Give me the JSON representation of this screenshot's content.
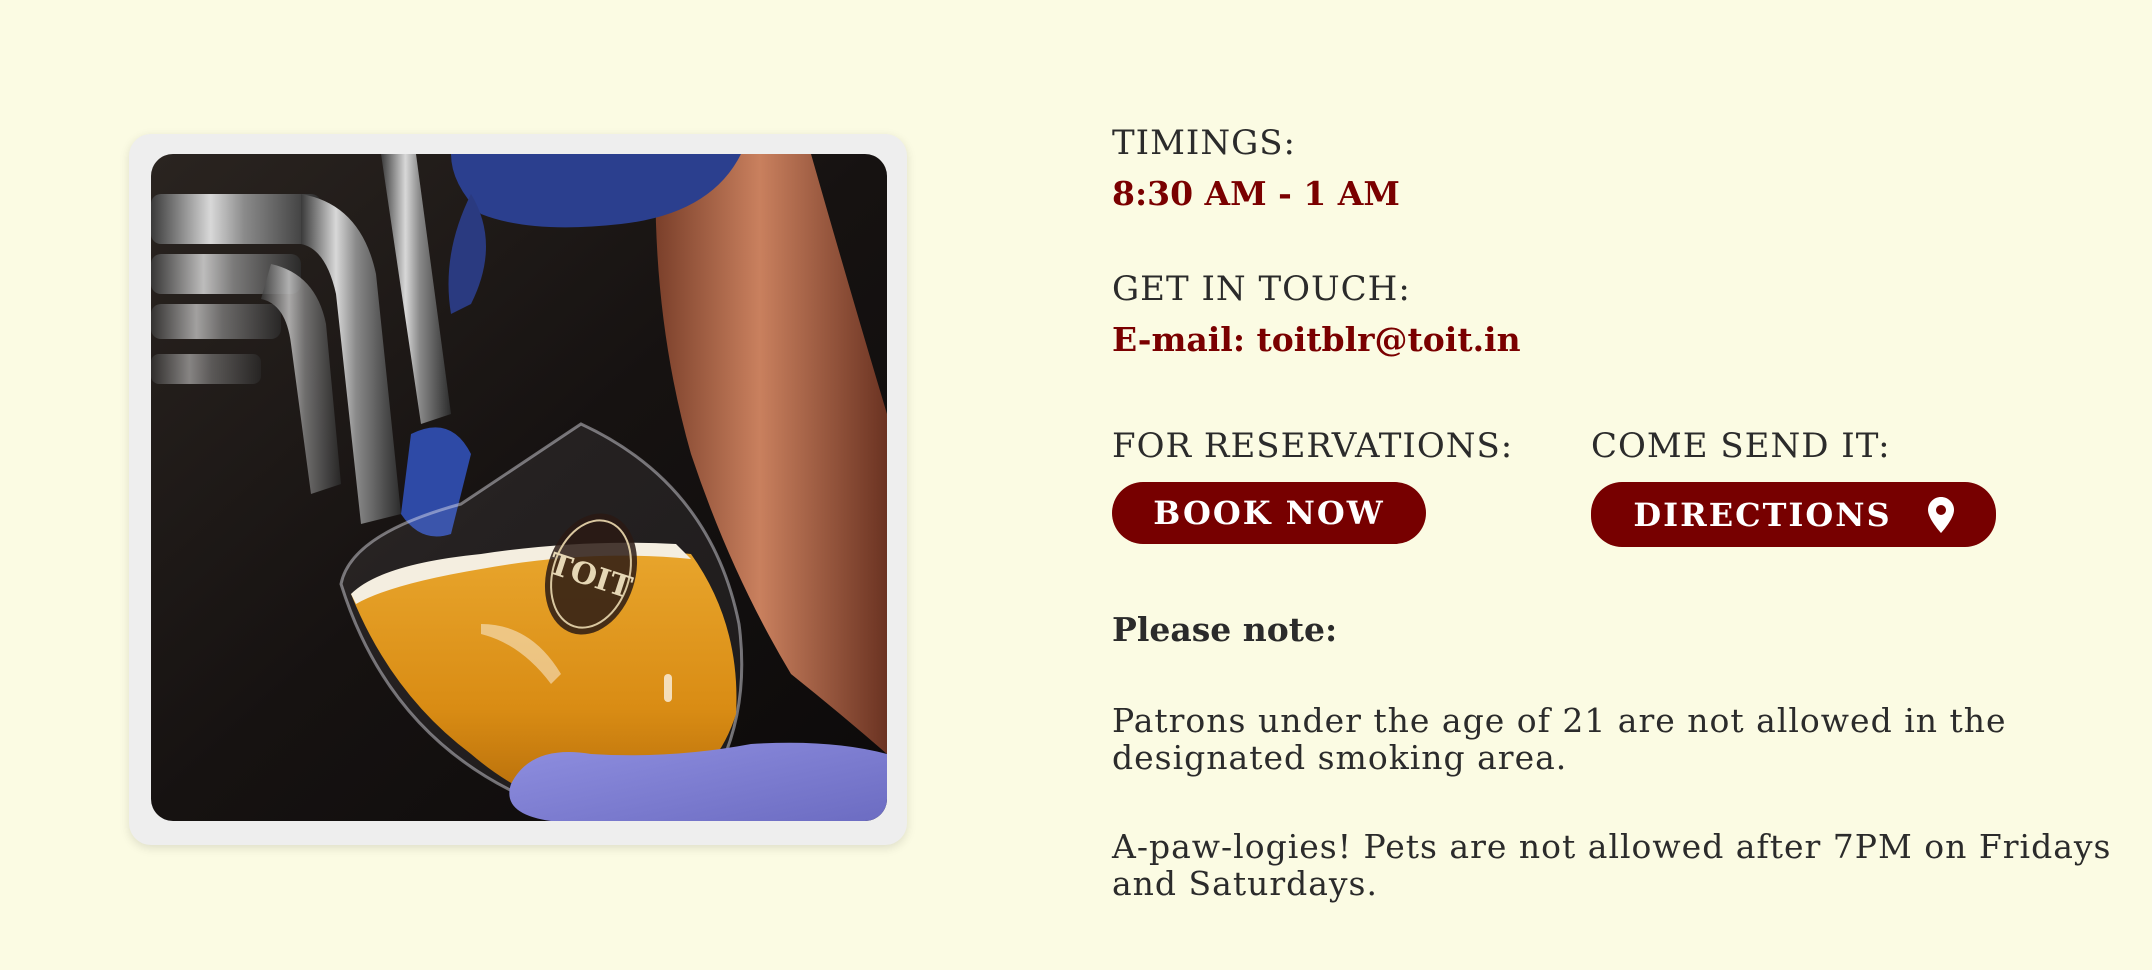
{
  "photo": {
    "alt": "Bartender pouring beer from a tap into a TOIT glass",
    "glass_logo_text": "TOIT"
  },
  "timings": {
    "label": "TIMINGS:",
    "value": "8:30 AM - 1 AM"
  },
  "contact": {
    "label": "GET IN TOUCH:",
    "email": "E-mail: toitblr@toit.in"
  },
  "reservations": {
    "label": "FOR RESERVATIONS:",
    "button_label": "BOOK NOW"
  },
  "directions": {
    "label": "COME SEND IT:",
    "button_label": "DIRECTIONS",
    "icon": "map-pin-icon"
  },
  "notes": {
    "title": "Please note:",
    "items": [
      "Patrons under the age of 21 are not allowed in the designated smoking area.",
      "A-paw-logies! Pets are not allowed after 7PM on Fridays and Saturdays."
    ]
  },
  "colors": {
    "background": "#fbfbe3",
    "accent": "#770000",
    "text": "#2b2b2b"
  }
}
